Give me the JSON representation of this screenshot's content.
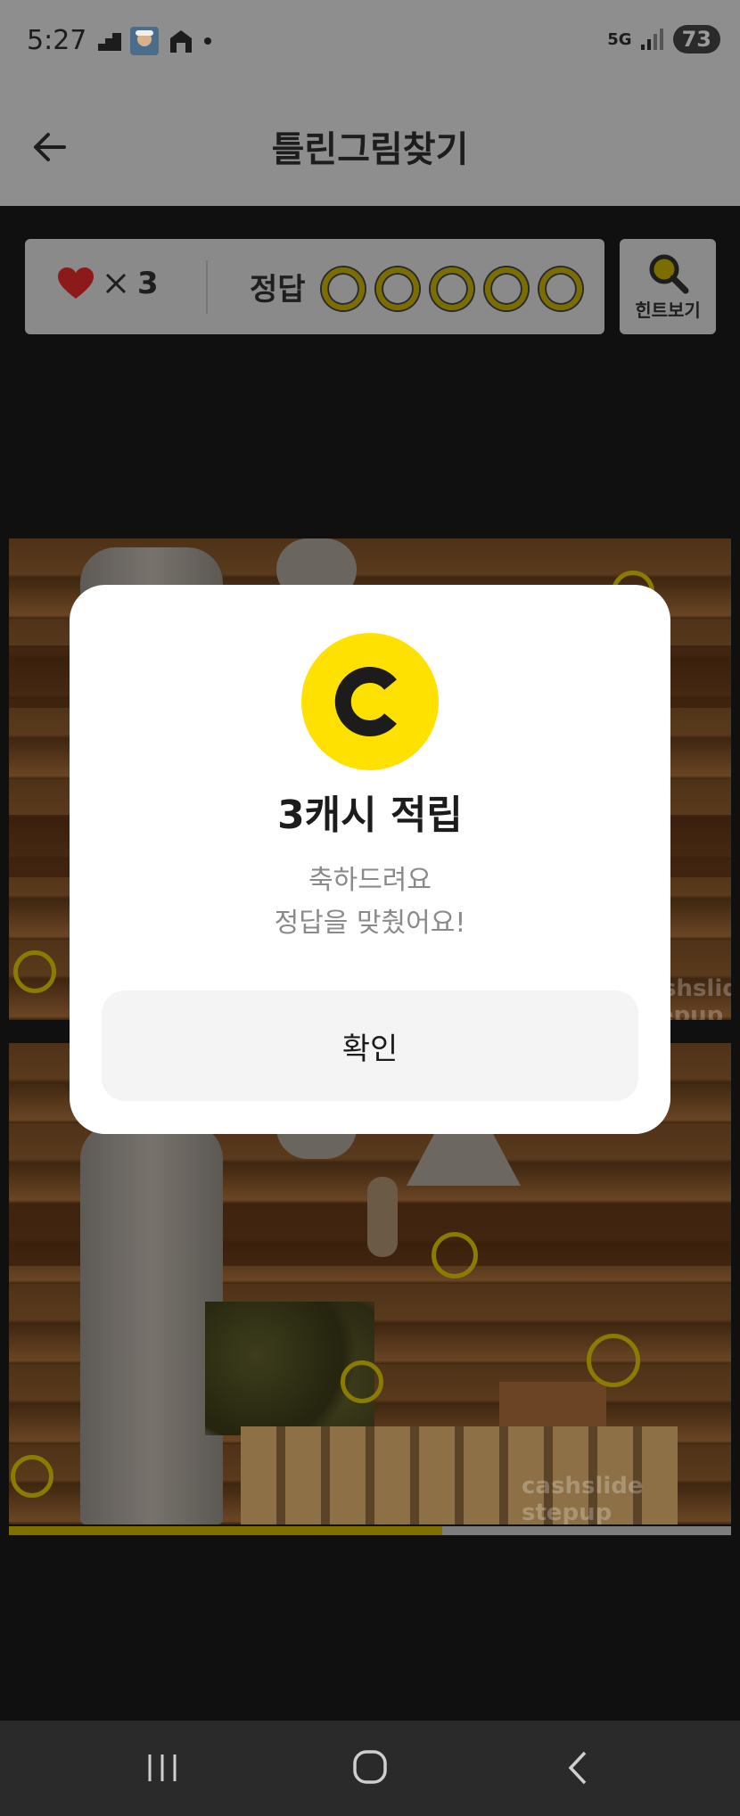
{
  "status_bar": {
    "time": "5:27",
    "network": "5G",
    "battery": "73"
  },
  "header": {
    "title": "틀린그림찾기"
  },
  "game_bar": {
    "lives_count": "3",
    "answer_label": "정답",
    "answers_found": 0,
    "answers_total": 5,
    "hint_label": "힌트보기"
  },
  "puzzle": {
    "watermark": "cashslide stepup",
    "progress_fraction": 0.6
  },
  "dialog": {
    "coin_letter": "C",
    "title": "3캐시 적립",
    "message_line1": "축하드려요",
    "message_line2": "정답을 맞췄어요!",
    "confirm_label": "확인"
  },
  "colors": {
    "accent_yellow": "#ffe100",
    "heart_red": "#8c1a1a",
    "overlay_gray": "#8e8e8e"
  }
}
